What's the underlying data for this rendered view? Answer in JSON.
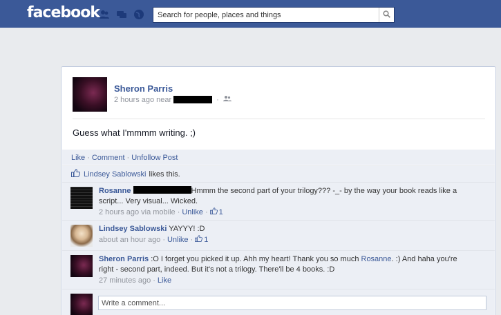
{
  "topbar": {
    "logo": "facebook",
    "search_placeholder": "Search for people, places and things"
  },
  "post": {
    "author": "Sheron Parris",
    "time": "2 hours ago near",
    "text": "Guess what I'mmmm writing. ;)"
  },
  "actions": {
    "like": "Like",
    "comment": "Comment",
    "unfollow": "Unfollow Post"
  },
  "likes": {
    "name": "Lindsey Sablowski",
    "rest": "likes this."
  },
  "comments": [
    {
      "name": "Rosanne",
      "text": "Hmmm the second part of your trilogy??? -_- by the way your book reads like a script... Very visual... Wicked.",
      "time": "2 hours ago via mobile",
      "action": "Unlike",
      "likes": "1"
    },
    {
      "name": "Lindsey Sablowski",
      "text": "YAYYY! :D",
      "time": "about an hour ago",
      "action": "Unlike",
      "likes": "1"
    },
    {
      "name": "Sheron Parris",
      "text_before": ":O I forget you picked it up. Ahh my heart! Thank you so much",
      "mention": "Rosanne",
      "text_after": ". :) And haha you're right - second part, indeed. But it's not a trilogy. There'll be 4 books. :D",
      "time": "27 minutes ago",
      "action": "Like"
    }
  ],
  "write_placeholder": "Write a comment...",
  "colors": {
    "brand": "#3b5998",
    "ufi_bg": "#eceff5"
  }
}
